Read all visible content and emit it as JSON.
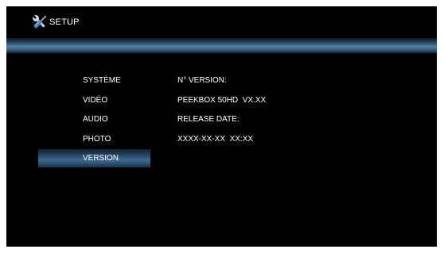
{
  "header": {
    "title": "SETUP",
    "icon": "tools-icon"
  },
  "menu": {
    "selected_index": 4,
    "items": [
      {
        "label": "SYSTÈME"
      },
      {
        "label": "VIDÉO"
      },
      {
        "label": "AUDIO"
      },
      {
        "label": "PHOTO"
      },
      {
        "label": "VERSION"
      }
    ]
  },
  "version_info": {
    "version_label": "N° VERSION:",
    "version_value": "PEEKBOX 50HD  VX.XX",
    "release_label": "RELEASE DATE:",
    "release_value": "XXXX-XX-XX  XX:XX"
  },
  "colors": {
    "background": "#000000",
    "accent": "#4f7fa6",
    "text": "#ffffff"
  }
}
